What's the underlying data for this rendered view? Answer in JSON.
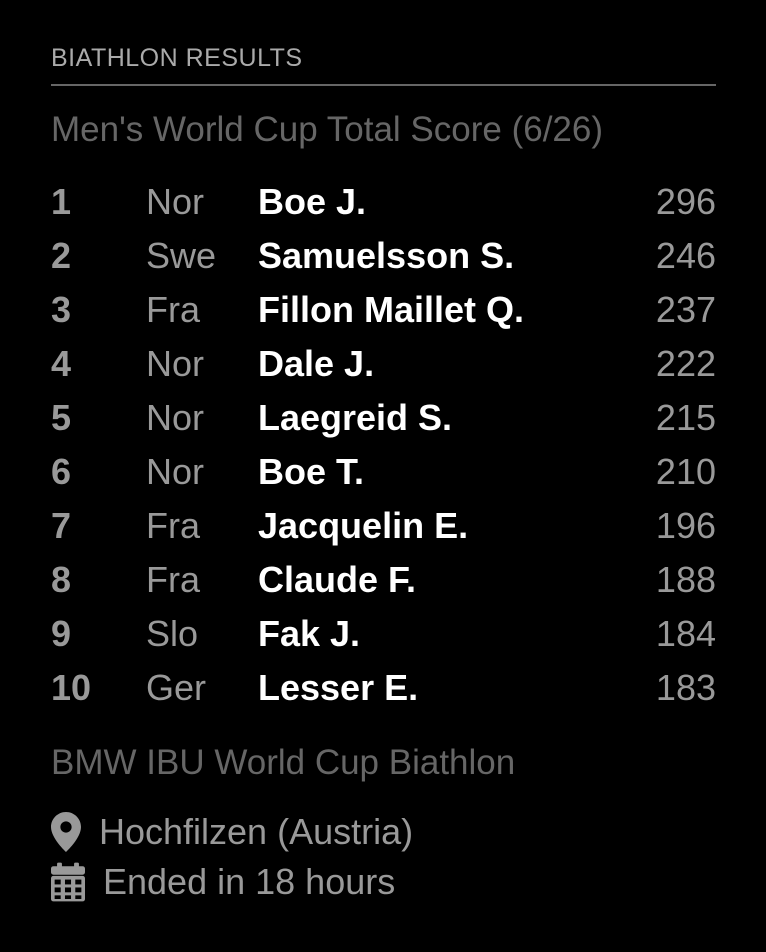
{
  "module": {
    "header": "Biathlon Results",
    "subtitle": "Men's World Cup Total Score (6/26)"
  },
  "results": [
    {
      "rank": "1",
      "nation": "Nor",
      "name": "Boe J.",
      "points": "296"
    },
    {
      "rank": "2",
      "nation": "Swe",
      "name": "Samuelsson S.",
      "points": "246"
    },
    {
      "rank": "3",
      "nation": "Fra",
      "name": "Fillon Maillet Q.",
      "points": "237"
    },
    {
      "rank": "4",
      "nation": "Nor",
      "name": "Dale J.",
      "points": "222"
    },
    {
      "rank": "5",
      "nation": "Nor",
      "name": "Laegreid S.",
      "points": "215"
    },
    {
      "rank": "6",
      "nation": "Nor",
      "name": "Boe T.",
      "points": "210"
    },
    {
      "rank": "7",
      "nation": "Fra",
      "name": "Jacquelin E.",
      "points": "196"
    },
    {
      "rank": "8",
      "nation": "Fra",
      "name": "Claude F.",
      "points": "188"
    },
    {
      "rank": "9",
      "nation": "Slo",
      "name": "Fak J.",
      "points": "184"
    },
    {
      "rank": "10",
      "nation": "Ger",
      "name": "Lesser E.",
      "points": "183"
    }
  ],
  "event": {
    "name": "BMW IBU World Cup Biathlon",
    "location": "Hochfilzen (Austria)",
    "location_icon": "map-marker-icon",
    "status": "Ended in 18 hours",
    "status_icon": "calendar-icon"
  },
  "colors": {
    "background": "#000000",
    "athlete_name": "#ffffff",
    "secondary_text": "#999999",
    "dim_text": "#666666"
  }
}
